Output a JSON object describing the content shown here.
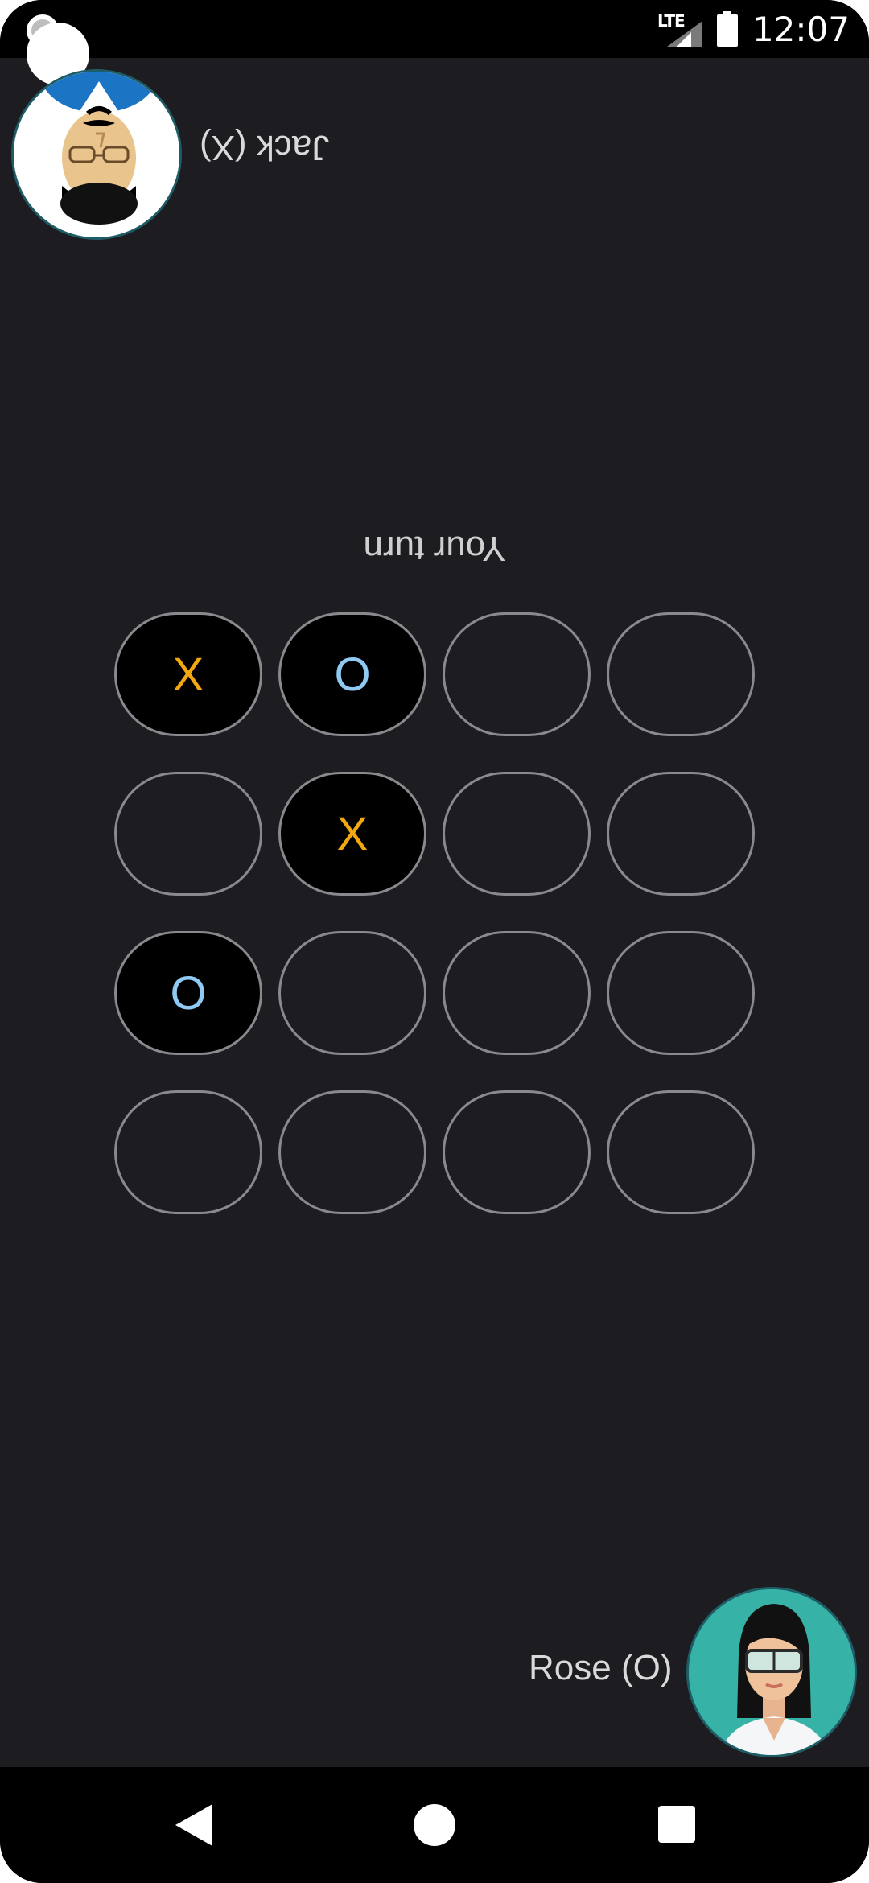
{
  "status_bar": {
    "network": "LTE",
    "time": "12:07"
  },
  "players": {
    "top": {
      "name": "Jack (X)",
      "avatar_icon": "man-avatar-icon"
    },
    "bottom": {
      "name": "Rose (O)",
      "avatar_icon": "woman-avatar-icon"
    }
  },
  "game": {
    "turn_message": "Your turn",
    "colors": {
      "x": "#f3a711",
      "o": "#8ecaf4",
      "cell_border": "#8a8a8e",
      "background": "#1d1d21"
    },
    "board": [
      [
        "X",
        "O",
        "",
        ""
      ],
      [
        "",
        "X",
        "",
        ""
      ],
      [
        "O",
        "",
        "",
        ""
      ],
      [
        "",
        "",
        "",
        ""
      ]
    ]
  },
  "nav": {
    "back": "back-icon",
    "home": "home-icon",
    "recents": "recents-icon"
  }
}
